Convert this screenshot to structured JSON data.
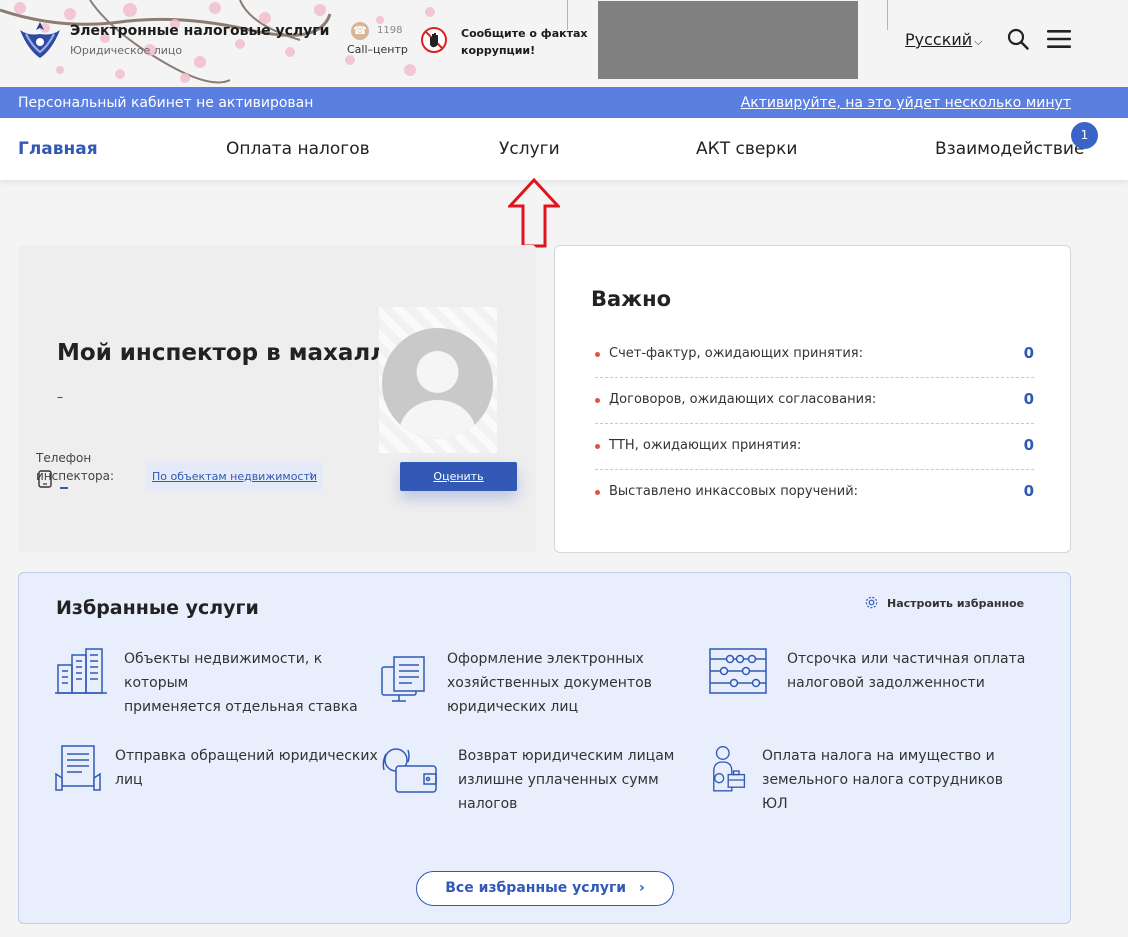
{
  "header": {
    "brand_title": "Электронные налоговые услуги",
    "brand_subtitle": "Юридическое лицо",
    "call_number": "1198",
    "call_label": "Call–центр",
    "corruption_line1": "Сообщите о фактах",
    "corruption_line2": "коррупции!",
    "language": "Русский"
  },
  "activation": {
    "status": "Персональный кабинет не активирован",
    "link": "Активируйте, на это уйдет несколько минут"
  },
  "nav": {
    "items": [
      "Главная",
      "Оплата налогов",
      "Услуги",
      "АКТ сверки",
      "Взаимодействие"
    ],
    "active": "Главная",
    "badge": "1"
  },
  "inspector": {
    "title": "Мой инспектор в махалле",
    "name": "–",
    "phone_label": "Телефон инспектора:",
    "objects_button": "По объектам недвижимости",
    "rate_button": "Оценить"
  },
  "important": {
    "title": "Важно",
    "rows": [
      {
        "label": "Счет-фактур, ожидающих принятия:",
        "value": "0"
      },
      {
        "label": "Договоров, ожидающих согласования:",
        "value": "0"
      },
      {
        "label": "ТТН, ожидающих принятия:",
        "value": "0"
      },
      {
        "label": "Выставлено инкассовых поручений:",
        "value": "0"
      }
    ]
  },
  "favorites": {
    "title": "Избранные услуги",
    "settings": "Настроить избранное",
    "services": [
      {
        "icon": "buildings-icon",
        "lines": [
          "Объекты недвижимости, к которым",
          "применяется отдельная ставка"
        ]
      },
      {
        "icon": "e-document-icon",
        "lines": [
          "Оформление электронных",
          "хозяйственных документов",
          "юридических лиц"
        ]
      },
      {
        "icon": "abacus-icon",
        "lines": [
          "Отсрочка или частичная оплата",
          "налоговой задолженности"
        ]
      },
      {
        "icon": "appeal-document-icon",
        "lines": [
          "Отправка обращений юридических",
          "лиц"
        ]
      },
      {
        "icon": "refund-wallet-icon",
        "lines": [
          "Возврат юридическим лицам",
          "излишне уплаченных сумм",
          "налогов"
        ]
      },
      {
        "icon": "employee-tax-icon",
        "lines": [
          "Оплата налога на имущество и",
          "земельного налога сотрудников",
          "ЮЛ"
        ]
      }
    ],
    "all_button": "Все избранные услуги"
  },
  "colors": {
    "accent": "#3159b5",
    "strip": "#5b7fe0",
    "highlight_arrow": "#e0141a"
  }
}
